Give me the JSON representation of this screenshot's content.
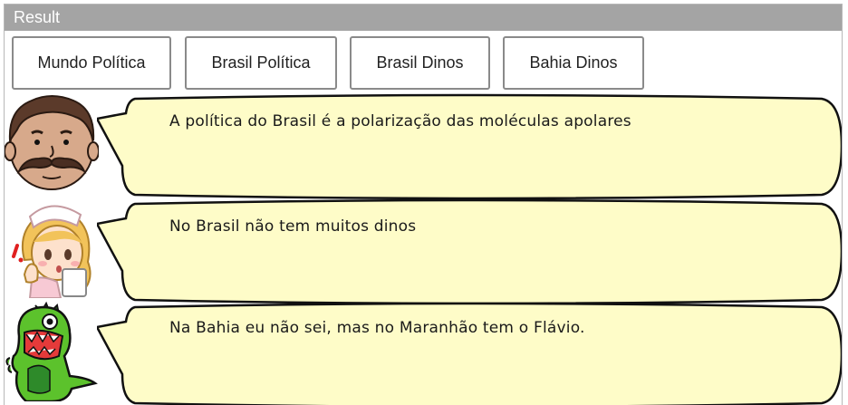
{
  "panel": {
    "title": "Result"
  },
  "buttons": [
    {
      "label": "Mundo Política"
    },
    {
      "label": "Brasil Política"
    },
    {
      "label": "Brasil Dinos"
    },
    {
      "label": "Bahia Dinos"
    }
  ],
  "dialogue": [
    {
      "avatar": "man-with-mustache-icon",
      "text": "A política do Brasil é a polarização das moléculas apolares"
    },
    {
      "avatar": "nurse-girl-icon",
      "text": "No Brasil não tem muitos dinos"
    },
    {
      "avatar": "green-dinosaur-icon",
      "text": "Na Bahia eu não sei, mas no Maranhão tem o Flávio."
    }
  ],
  "colors": {
    "titlebar": "#a4a4a4",
    "bubble_fill": "#fefcc8",
    "bubble_stroke": "#111111"
  }
}
